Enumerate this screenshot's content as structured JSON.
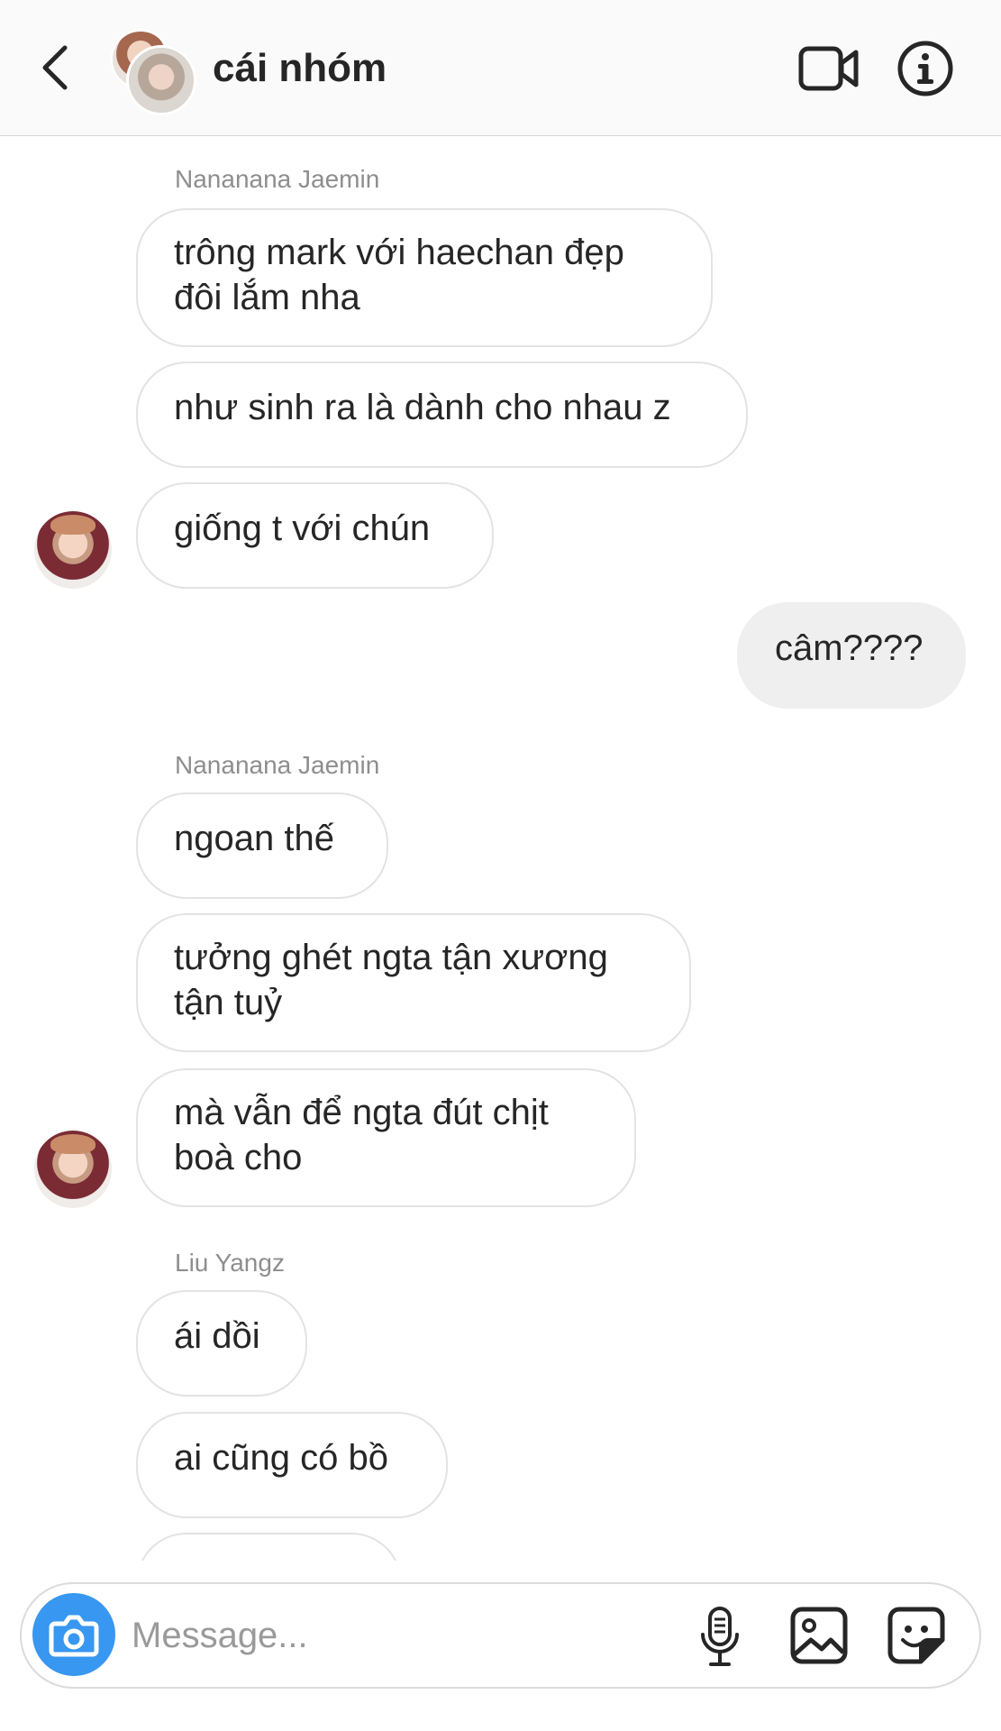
{
  "header": {
    "title": "cái nhóm",
    "back_icon": "chevron-left-icon",
    "video_icon": "video-camera-icon",
    "info_icon": "info-icon"
  },
  "messages": {
    "sender_1": "Nananana Jaemin",
    "m1": "trông mark với haechan đẹp đôi lắm nha",
    "m2": "như sinh ra là dành cho nhau z",
    "m3": "giống t với chún",
    "mine_1": "câm????",
    "sender_2": "Nananana Jaemin",
    "m4": "ngoan thế",
    "m5": "tưởng ghét ngta tận xương tận tuỷ",
    "m6": "mà vẫn để ngta đút chịt boà cho",
    "sender_3": "Liu Yangz",
    "m7": "ái dồi",
    "m8": "ai cũng có bồ"
  },
  "composer": {
    "placeholder": "Message...",
    "camera_icon": "camera-icon",
    "mic_icon": "microphone-icon",
    "gallery_icon": "gallery-icon",
    "sticker_icon": "sticker-icon"
  },
  "colors": {
    "accent": "#3897f0",
    "header_bg": "#fafafa",
    "bubble_border": "#e3e3e3",
    "own_bubble": "#efefef",
    "secondary_text": "#8e8e8e"
  }
}
